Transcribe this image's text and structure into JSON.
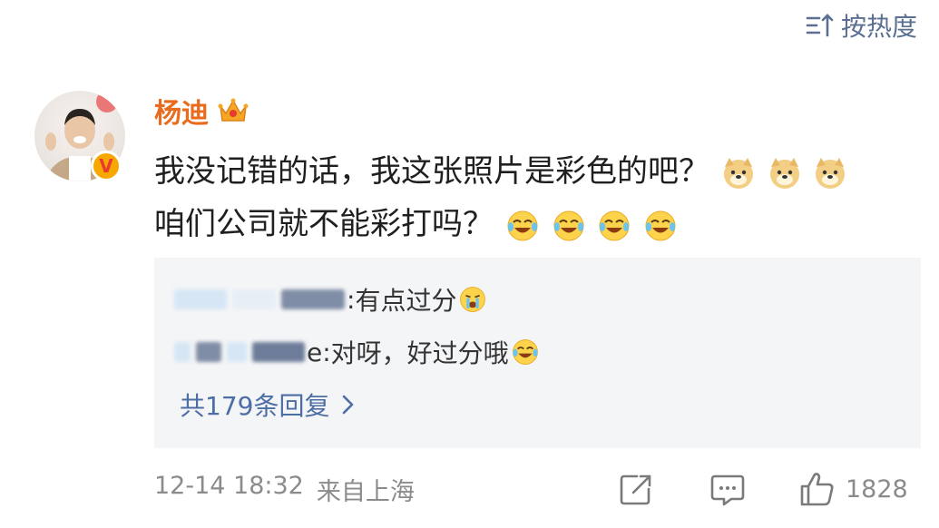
{
  "sort": {
    "label": "按热度",
    "icon": "sort-icon"
  },
  "comment": {
    "username": "杨迪",
    "username_color": "#e86b1e",
    "badge_icon": "crown-icon",
    "verified": "V",
    "line1": "我没记错的话，我这张照片是彩色的吧？",
    "line2": "咱们公司就不能彩打吗？",
    "line1_emojis": [
      "doge-emoji",
      "doge-emoji",
      "doge-emoji"
    ],
    "line2_emojis": [
      "laugh-cry-emoji",
      "laugh-cry-emoji",
      "laugh-cry-emoji",
      "laugh-cry-emoji"
    ]
  },
  "replies": [
    {
      "name_suffix": ": ",
      "text": "有点过分",
      "emoji": "crying-emoji"
    },
    {
      "name_suffix": "e: ",
      "text": "对呀，好过分哦",
      "emoji": "laugh-cry-emoji"
    }
  ],
  "more_replies_label": "共179条回复",
  "footer": {
    "time": "12-14 18:32",
    "source": "来自上海",
    "like_count": "1828"
  },
  "colors": {
    "link": "#4d6ea5",
    "meta": "#8b8b8b",
    "reply_bg": "#f4f5f7"
  }
}
